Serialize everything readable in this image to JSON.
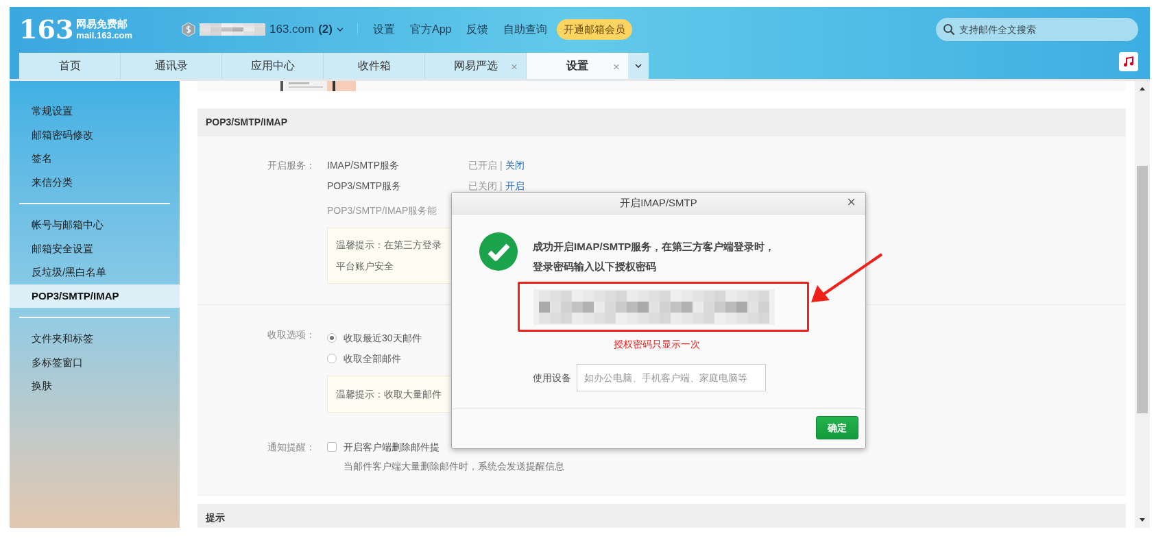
{
  "header": {
    "logo": {
      "number": "163",
      "title": "网易免费邮",
      "domain": "mail.163.com"
    },
    "account": {
      "address": "163.com",
      "count": "(2)"
    },
    "nav": [
      "设置",
      "官方App",
      "反馈",
      "自助查询"
    ],
    "vip_button": "开通邮箱会员",
    "search": {
      "placeholder": "支持邮件全文搜索"
    }
  },
  "tabs": [
    {
      "label": "首页",
      "selected": false
    },
    {
      "label": "通讯录",
      "selected": false
    },
    {
      "label": "应用中心",
      "selected": false
    },
    {
      "label": "收件箱",
      "selected": false
    },
    {
      "label": "网易严选",
      "selected": false,
      "close": "×"
    },
    {
      "label": "设置",
      "selected": true,
      "close": "×"
    }
  ],
  "sidebar": {
    "groups": [
      [
        {
          "label": "常规设置",
          "selected": false
        },
        {
          "label": "邮箱密码修改",
          "selected": false
        },
        {
          "label": "签名",
          "selected": false
        },
        {
          "label": "来信分类",
          "selected": false
        }
      ],
      [
        {
          "label": "帐号与邮箱中心",
          "selected": false
        },
        {
          "label": "邮箱安全设置",
          "selected": false
        },
        {
          "label": "反垃圾/黑白名单",
          "selected": false
        },
        {
          "label": "POP3/SMTP/IMAP",
          "selected": true
        }
      ],
      [
        {
          "label": "文件夹和标签",
          "selected": false
        },
        {
          "label": "多标签窗口",
          "selected": false
        },
        {
          "label": "换肤",
          "selected": false
        }
      ]
    ]
  },
  "pop_section": {
    "title": "POP3/SMTP/IMAP",
    "services": {
      "label": "开启服务：",
      "items": [
        {
          "name": "IMAP/SMTP服务",
          "status": "已开启",
          "separator": "|",
          "action": "关闭"
        },
        {
          "name": "POP3/SMTP服务",
          "status": "已关闭",
          "separator": "|",
          "action": "开启"
        }
      ],
      "description": "POP3/SMTP/IMAP服务能",
      "tip": [
        "温馨提示：在第三方登录",
        "平台账户安全"
      ]
    },
    "fetch": {
      "label": "收取选项：",
      "options": [
        {
          "label": "收取最近30天邮件",
          "selected": true
        },
        {
          "label": "收取全部邮件",
          "selected": false
        }
      ],
      "tip": [
        "温馨提示：收取大量邮件"
      ]
    },
    "notify": {
      "label": "通知提醒：",
      "option": {
        "label": "开启客户端删除邮件提",
        "checked": false
      },
      "note": "当邮件客户端大量删除邮件时，系统会发送提醒信息"
    }
  },
  "tips_section": {
    "title": "提示"
  },
  "dialog": {
    "title": "开启IMAP/SMTP",
    "close": "×",
    "message": "成功开启IMAP/SMTP服务，在第三方客户端登录时，登录密码输入以下授权密码",
    "warning": "授权密码只显示一次",
    "device": {
      "label": "使用设备",
      "placeholder": "如办公电脑、手机客户端、家庭电脑等"
    },
    "confirm": "确定"
  }
}
